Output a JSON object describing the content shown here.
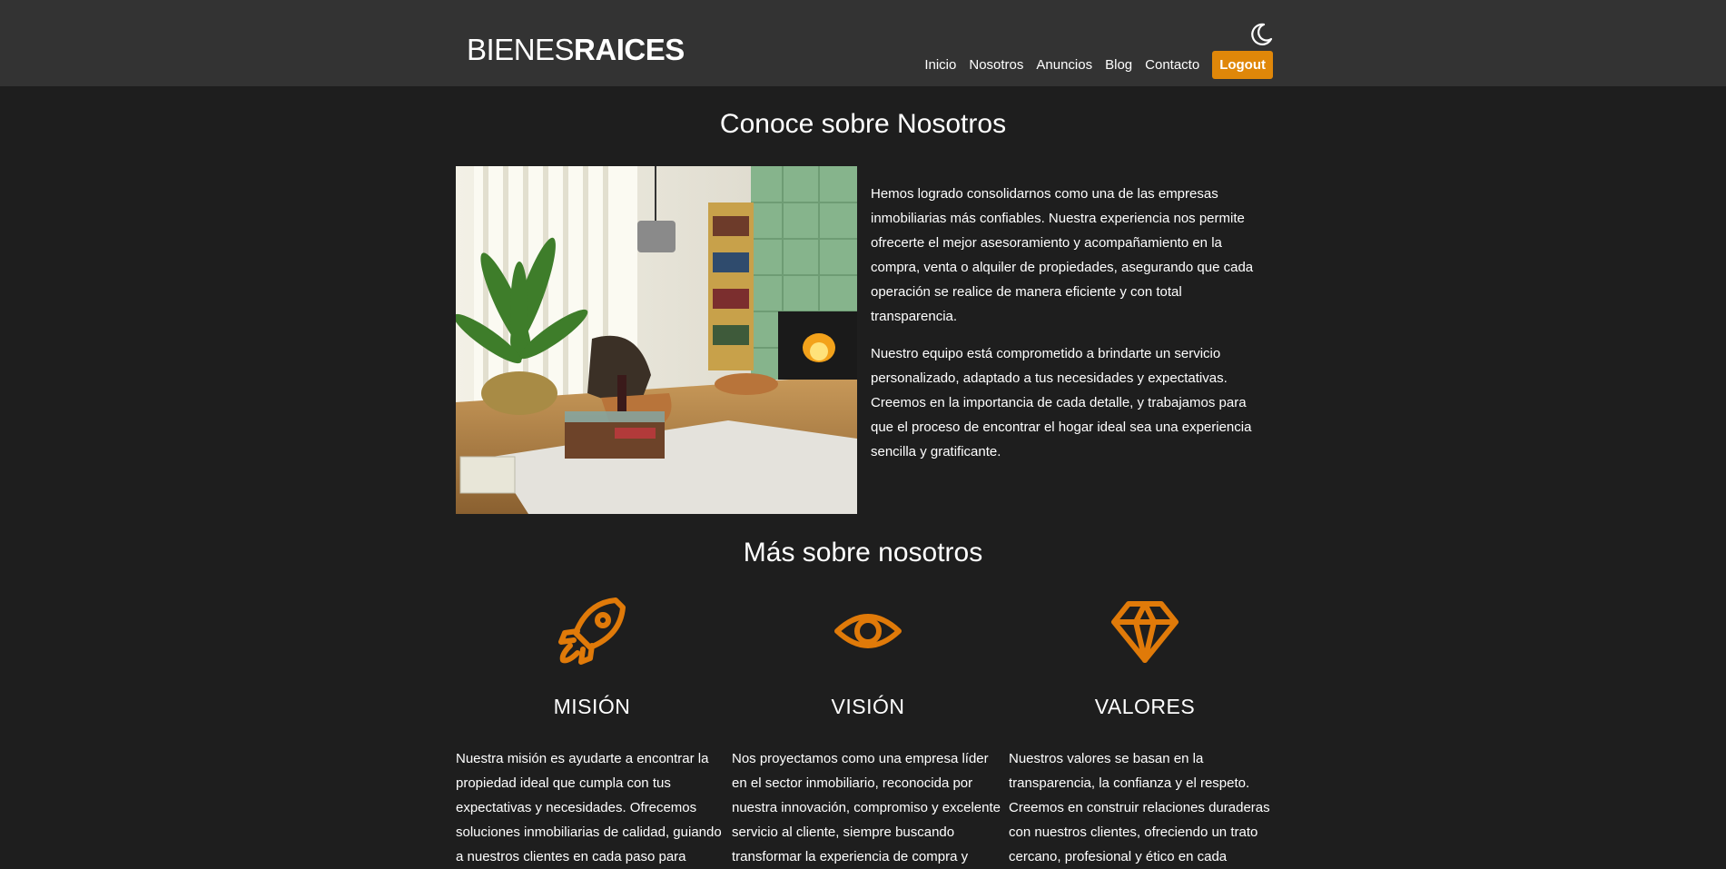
{
  "header": {
    "logo_light": "BIENES",
    "logo_bold": "RAICES",
    "nav": [
      "Inicio",
      "Nosotros",
      "Anuncios",
      "Blog",
      "Contacto"
    ],
    "logout_label": "Logout",
    "theme_toggle_icon": "moon-icon"
  },
  "colors": {
    "background": "#1e1e1e",
    "header": "#333333",
    "accent": "#e08709"
  },
  "about": {
    "title": "Conoce sobre Nosotros",
    "paragraphs": [
      "Hemos logrado consolidarnos como una de las empresas inmobiliarias más confiables. Nuestra experiencia nos permite ofrecerte el mejor asesoramiento y acompañamiento en la compra, venta o alquiler de propiedades, asegurando que cada operación se realice de manera eficiente y con total transparencia.",
      "Nuestro equipo está comprometido a brindarte un servicio personalizado, adaptado a tus necesidades y expectativas. Creemos en la importancia de cada detalle, y trabajamos para que el proceso de encontrar el hogar ideal sea una experiencia sencilla y gratificante."
    ]
  },
  "more": {
    "title": "Más sobre nosotros",
    "features": [
      {
        "icon": "rocket-icon",
        "title": "MISIÓN",
        "text": "Nuestra misión es ayudarte a encontrar la propiedad ideal que cumpla con tus expectativas y necesidades. Ofrecemos soluciones inmobiliarias de calidad, guiando a nuestros clientes en cada paso para"
      },
      {
        "icon": "eye-icon",
        "title": "VISIÓN",
        "text": "Nos proyectamos como una empresa líder en el sector inmobiliario, reconocida por nuestra innovación, compromiso y excelente servicio al cliente, siempre buscando transformar la experiencia de compra y"
      },
      {
        "icon": "diamond-icon",
        "title": "VALORES",
        "text": "Nuestros valores se basan en la transparencia, la confianza y el respeto. Creemos en construir relaciones duraderas con nuestros clientes, ofreciendo un trato cercano, profesional y ético en cada"
      }
    ]
  }
}
